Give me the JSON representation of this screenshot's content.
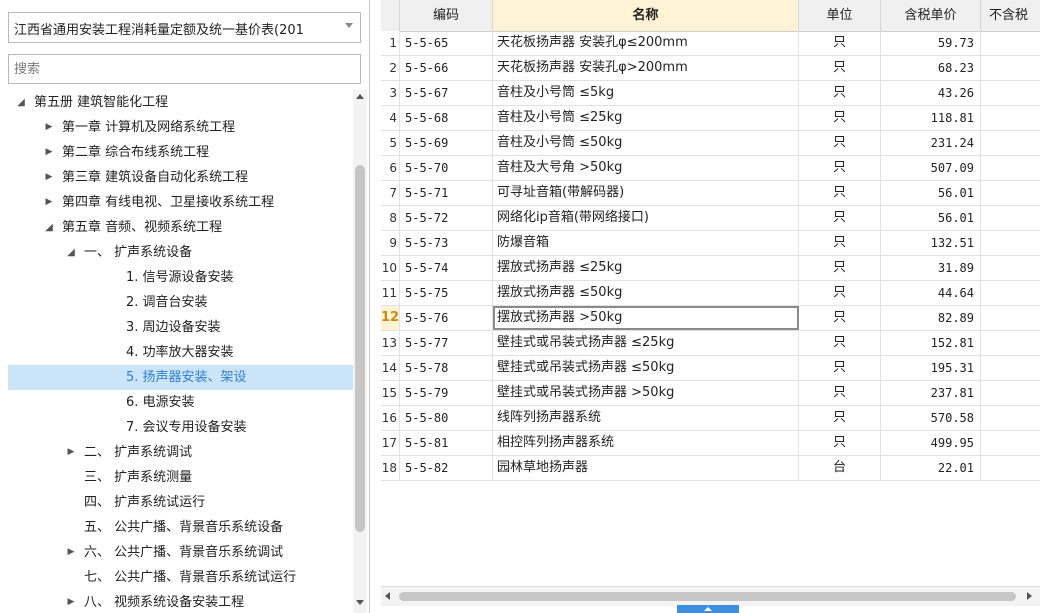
{
  "left_panel": {
    "dropdown_value": "江西省通用安装工程消耗量定额及统一基价表(201",
    "search_placeholder": "搜索",
    "tree": [
      {
        "label": "第五册 建筑智能化工程",
        "level": 0,
        "toggle": "expanded"
      },
      {
        "label": "第一章 计算机及网络系统工程",
        "level": 1,
        "toggle": "collapsed"
      },
      {
        "label": "第二章 综合布线系统工程",
        "level": 1,
        "toggle": "collapsed"
      },
      {
        "label": "第三章 建筑设备自动化系统工程",
        "level": 1,
        "toggle": "collapsed"
      },
      {
        "label": "第四章 有线电视、卫星接收系统工程",
        "level": 1,
        "toggle": "collapsed"
      },
      {
        "label": "第五章 音频、视频系统工程",
        "level": 1,
        "toggle": "expanded"
      },
      {
        "label": "一、 扩声系统设备",
        "level": 2,
        "toggle": "expanded"
      },
      {
        "label": "1. 信号源设备安装",
        "level": 3,
        "toggle": "none"
      },
      {
        "label": "2. 调音台安装",
        "level": 3,
        "toggle": "none"
      },
      {
        "label": "3. 周边设备安装",
        "level": 3,
        "toggle": "none"
      },
      {
        "label": "4. 功率放大器安装",
        "level": 3,
        "toggle": "none"
      },
      {
        "label": "5. 扬声器安装、架设",
        "level": 3,
        "toggle": "none",
        "selected": true
      },
      {
        "label": "6. 电源安装",
        "level": 3,
        "toggle": "none"
      },
      {
        "label": "7. 会议专用设备安装",
        "level": 3,
        "toggle": "none"
      },
      {
        "label": "二、 扩声系统调试",
        "level": 2,
        "toggle": "collapsed"
      },
      {
        "label": "三、 扩声系统测量",
        "level": 2,
        "toggle": "none"
      },
      {
        "label": "四、 扩声系统试运行",
        "level": 2,
        "toggle": "none"
      },
      {
        "label": "五、 公共广播、背景音乐系统设备",
        "level": 2,
        "toggle": "none"
      },
      {
        "label": "六、 公共广播、背景音乐系统调试",
        "level": 2,
        "toggle": "collapsed"
      },
      {
        "label": "七、 公共广播、背景音乐系统试运行",
        "level": 2,
        "toggle": "none"
      },
      {
        "label": "八、 视频系统设备安装工程",
        "level": 2,
        "toggle": "collapsed"
      }
    ]
  },
  "grid": {
    "columns": {
      "code": "编码",
      "name": "名称",
      "unit": "单位",
      "price_tax": "含税单价",
      "price_notax": "不含税"
    },
    "current_row": 12,
    "rows": [
      {
        "no": "1",
        "code": "5-5-65",
        "name": "天花板扬声器 安装孔φ≤200mm",
        "unit": "只",
        "price": "59.73"
      },
      {
        "no": "2",
        "code": "5-5-66",
        "name": "天花板扬声器 安装孔φ>200mm",
        "unit": "只",
        "price": "68.23"
      },
      {
        "no": "3",
        "code": "5-5-67",
        "name": "音柱及小号筒 ≤5kg",
        "unit": "只",
        "price": "43.26"
      },
      {
        "no": "4",
        "code": "5-5-68",
        "name": "音柱及小号筒 ≤25kg",
        "unit": "只",
        "price": "118.81"
      },
      {
        "no": "5",
        "code": "5-5-69",
        "name": "音柱及小号筒 ≤50kg",
        "unit": "只",
        "price": "231.24"
      },
      {
        "no": "6",
        "code": "5-5-70",
        "name": "音柱及大号角 >50kg",
        "unit": "只",
        "price": "507.09"
      },
      {
        "no": "7",
        "code": "5-5-71",
        "name": "可寻址音箱(带解码器)",
        "unit": "只",
        "price": "56.01"
      },
      {
        "no": "8",
        "code": "5-5-72",
        "name": "网络化ip音箱(带网络接口)",
        "unit": "只",
        "price": "56.01"
      },
      {
        "no": "9",
        "code": "5-5-73",
        "name": "防爆音箱",
        "unit": "只",
        "price": "132.51"
      },
      {
        "no": "10",
        "code": "5-5-74",
        "name": "摆放式扬声器 ≤25kg",
        "unit": "只",
        "price": "31.89"
      },
      {
        "no": "11",
        "code": "5-5-75",
        "name": "摆放式扬声器 ≤50kg",
        "unit": "只",
        "price": "44.64"
      },
      {
        "no": "12",
        "code": "5-5-76",
        "name": "摆放式扬声器 >50kg",
        "unit": "只",
        "price": "82.89"
      },
      {
        "no": "13",
        "code": "5-5-77",
        "name": "壁挂式或吊装式扬声器 ≤25kg",
        "unit": "只",
        "price": "152.81"
      },
      {
        "no": "14",
        "code": "5-5-78",
        "name": "壁挂式或吊装式扬声器 ≤50kg",
        "unit": "只",
        "price": "195.31"
      },
      {
        "no": "15",
        "code": "5-5-79",
        "name": "壁挂式或吊装式扬声器 >50kg",
        "unit": "只",
        "price": "237.81"
      },
      {
        "no": "16",
        "code": "5-5-80",
        "name": "线阵列扬声器系统",
        "unit": "只",
        "price": "570.58"
      },
      {
        "no": "17",
        "code": "5-5-81",
        "name": "相控阵列扬声器系统",
        "unit": "只",
        "price": "499.95"
      },
      {
        "no": "18",
        "code": "5-5-82",
        "name": "园林草地扬声器",
        "unit": "台",
        "price": "22.01"
      }
    ]
  },
  "colors": {
    "selected_tree_bg": "#cce4f7",
    "selected_tree_text": "#2d7fd0",
    "header_highlight": "#fff3d6",
    "current_row_number": "#c98a12",
    "splitter": "#3d8fe0"
  },
  "icons": {
    "dropdown": "chevron-down-icon",
    "tree_expanded": "triangle-down-icon",
    "tree_collapsed": "triangle-right-icon",
    "scroll_up": "arrow-up-icon",
    "scroll_down": "arrow-down-icon",
    "scroll_left": "arrow-left-icon",
    "scroll_right": "arrow-right-icon"
  }
}
